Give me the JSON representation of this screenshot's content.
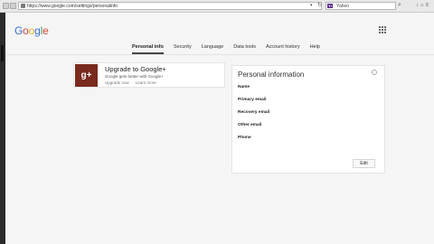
{
  "browser": {
    "url": "https://www.google.com/settings/personalinfo",
    "search_engine_badge": "Y!",
    "search_placeholder": "Yahoo",
    "icons": [
      "back-icon",
      "forward-icon",
      "lock-icon",
      "dropdown-icon",
      "reload-icon",
      "search-icon",
      "download-icon",
      "home-icon",
      "menu-icon"
    ]
  },
  "google": {
    "logo": {
      "G": "G",
      "o1": "o",
      "o2": "o",
      "g": "g",
      "l": "l",
      "e": "e"
    }
  },
  "tabs": [
    {
      "label": "Personal info",
      "active": true
    },
    {
      "label": "Security",
      "active": false
    },
    {
      "label": "Language",
      "active": false
    },
    {
      "label": "Data tools",
      "active": false
    },
    {
      "label": "Account history",
      "active": false
    },
    {
      "label": "Help",
      "active": false
    }
  ],
  "upgrade_card": {
    "badge": "g+",
    "title": "Upgrade to Google+",
    "subtitle": "Google gets better with Google+",
    "upgrade_link": "Upgrade now",
    "learn_link": "Learn more"
  },
  "personal_info": {
    "title": "Personal information",
    "fields": [
      "Name",
      "Primary email",
      "Recovery email",
      "Other email",
      "Phone"
    ],
    "edit_label": "Edit"
  },
  "colors": {
    "gplus_badge": "#7a2a1f",
    "logo_blue": "#3a6fd8",
    "logo_red": "#d64a3b",
    "logo_yellow": "#e7b12d",
    "logo_green": "#3aa55c"
  }
}
